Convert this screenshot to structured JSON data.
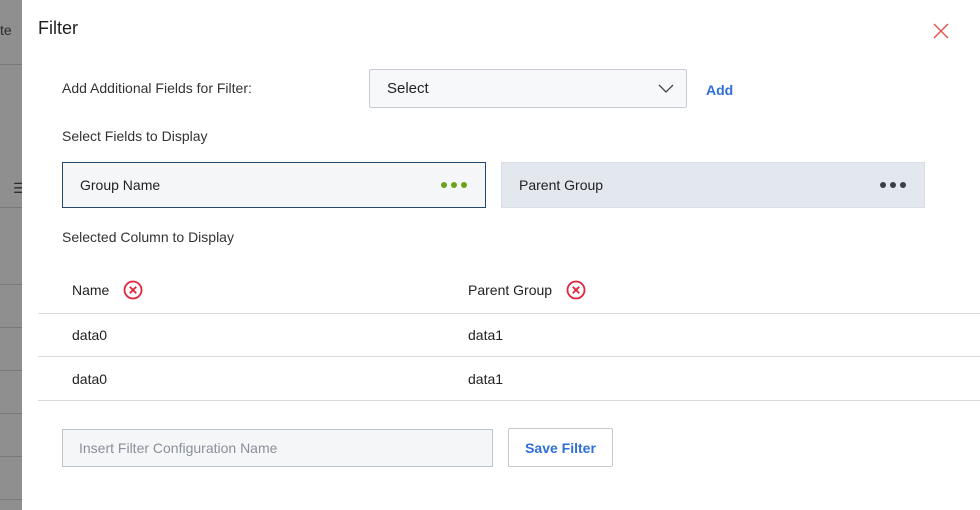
{
  "backdrop": {
    "text": "te"
  },
  "modal": {
    "title": "Filter",
    "additional_fields": {
      "label": "Add Additional Fields for Filter:",
      "select_value": "Select",
      "add_label": "Add"
    },
    "display_fields": {
      "label": "Select Fields to Display",
      "cards": [
        {
          "label": "Group Name",
          "active": true
        },
        {
          "label": "Parent Group",
          "active": false
        }
      ]
    },
    "selected_columns": {
      "label": "Selected Column to Display",
      "headers": [
        "Name",
        "Parent Group"
      ],
      "rows": [
        [
          "data0",
          "data1"
        ],
        [
          "data0",
          "data1"
        ]
      ]
    },
    "config": {
      "placeholder": "Insert Filter Configuration Name",
      "save_label": "Save Filter"
    }
  },
  "colors": {
    "accent": "#2e6fd8",
    "close": "#e0564a",
    "remove": "#e0243a",
    "dots_active": "#6aa318",
    "dots_inactive": "#3a3f47"
  }
}
